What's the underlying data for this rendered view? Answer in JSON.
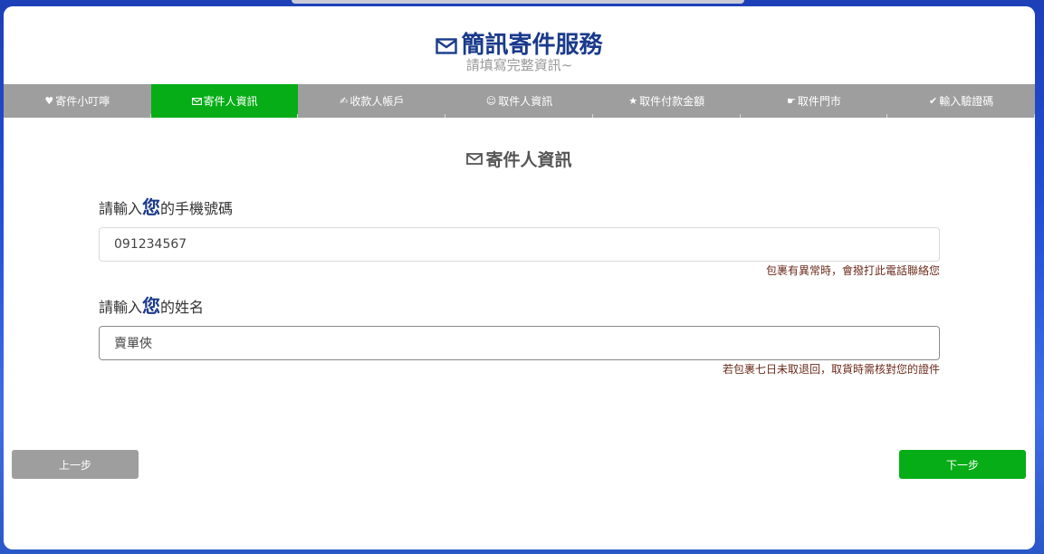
{
  "header": {
    "title": "簡訊寄件服務",
    "subtitle": "請填寫完整資訊~"
  },
  "tabs": [
    {
      "icon": "♥",
      "icon_name": "heart-icon",
      "label": "寄件小叮嚀",
      "active": false
    },
    {
      "icon": "",
      "icon_name": "mail-icon",
      "label": "寄件人資訊",
      "active": true
    },
    {
      "icon": "✍",
      "icon_name": "writing-hand-icon",
      "label": "收款人帳戶",
      "active": false
    },
    {
      "icon": "☺",
      "icon_name": "smiley-icon",
      "label": "取件人資訊",
      "active": false
    },
    {
      "icon": "★",
      "icon_name": "star-icon",
      "label": "取件付款金額",
      "active": false
    },
    {
      "icon": "☛",
      "icon_name": "pointing-hand-icon",
      "label": "取件門市",
      "active": false
    },
    {
      "icon": "✔",
      "icon_name": "check-icon",
      "label": "輸入驗證碼",
      "active": false
    }
  ],
  "section": {
    "title": "寄件人資訊"
  },
  "phone": {
    "label_prefix": "請輸入",
    "label_you": "您",
    "label_suffix": "的手機號碼",
    "value": "091234567",
    "hint": "包裹有異常時，會撥打此電話聯絡您"
  },
  "name": {
    "label_prefix": "請輸入",
    "label_you": "您",
    "label_suffix": "的姓名",
    "value": "賣單俠",
    "hint": "若包裹七日未取退回，取貨時需核對您的證件"
  },
  "buttons": {
    "prev": "上一步",
    "next": "下一步"
  },
  "colors": {
    "accent_green": "#06ad16",
    "title_blue": "#1a3a8c",
    "tab_gray": "#9e9e9e",
    "hint_brown": "#6b2b1c"
  }
}
